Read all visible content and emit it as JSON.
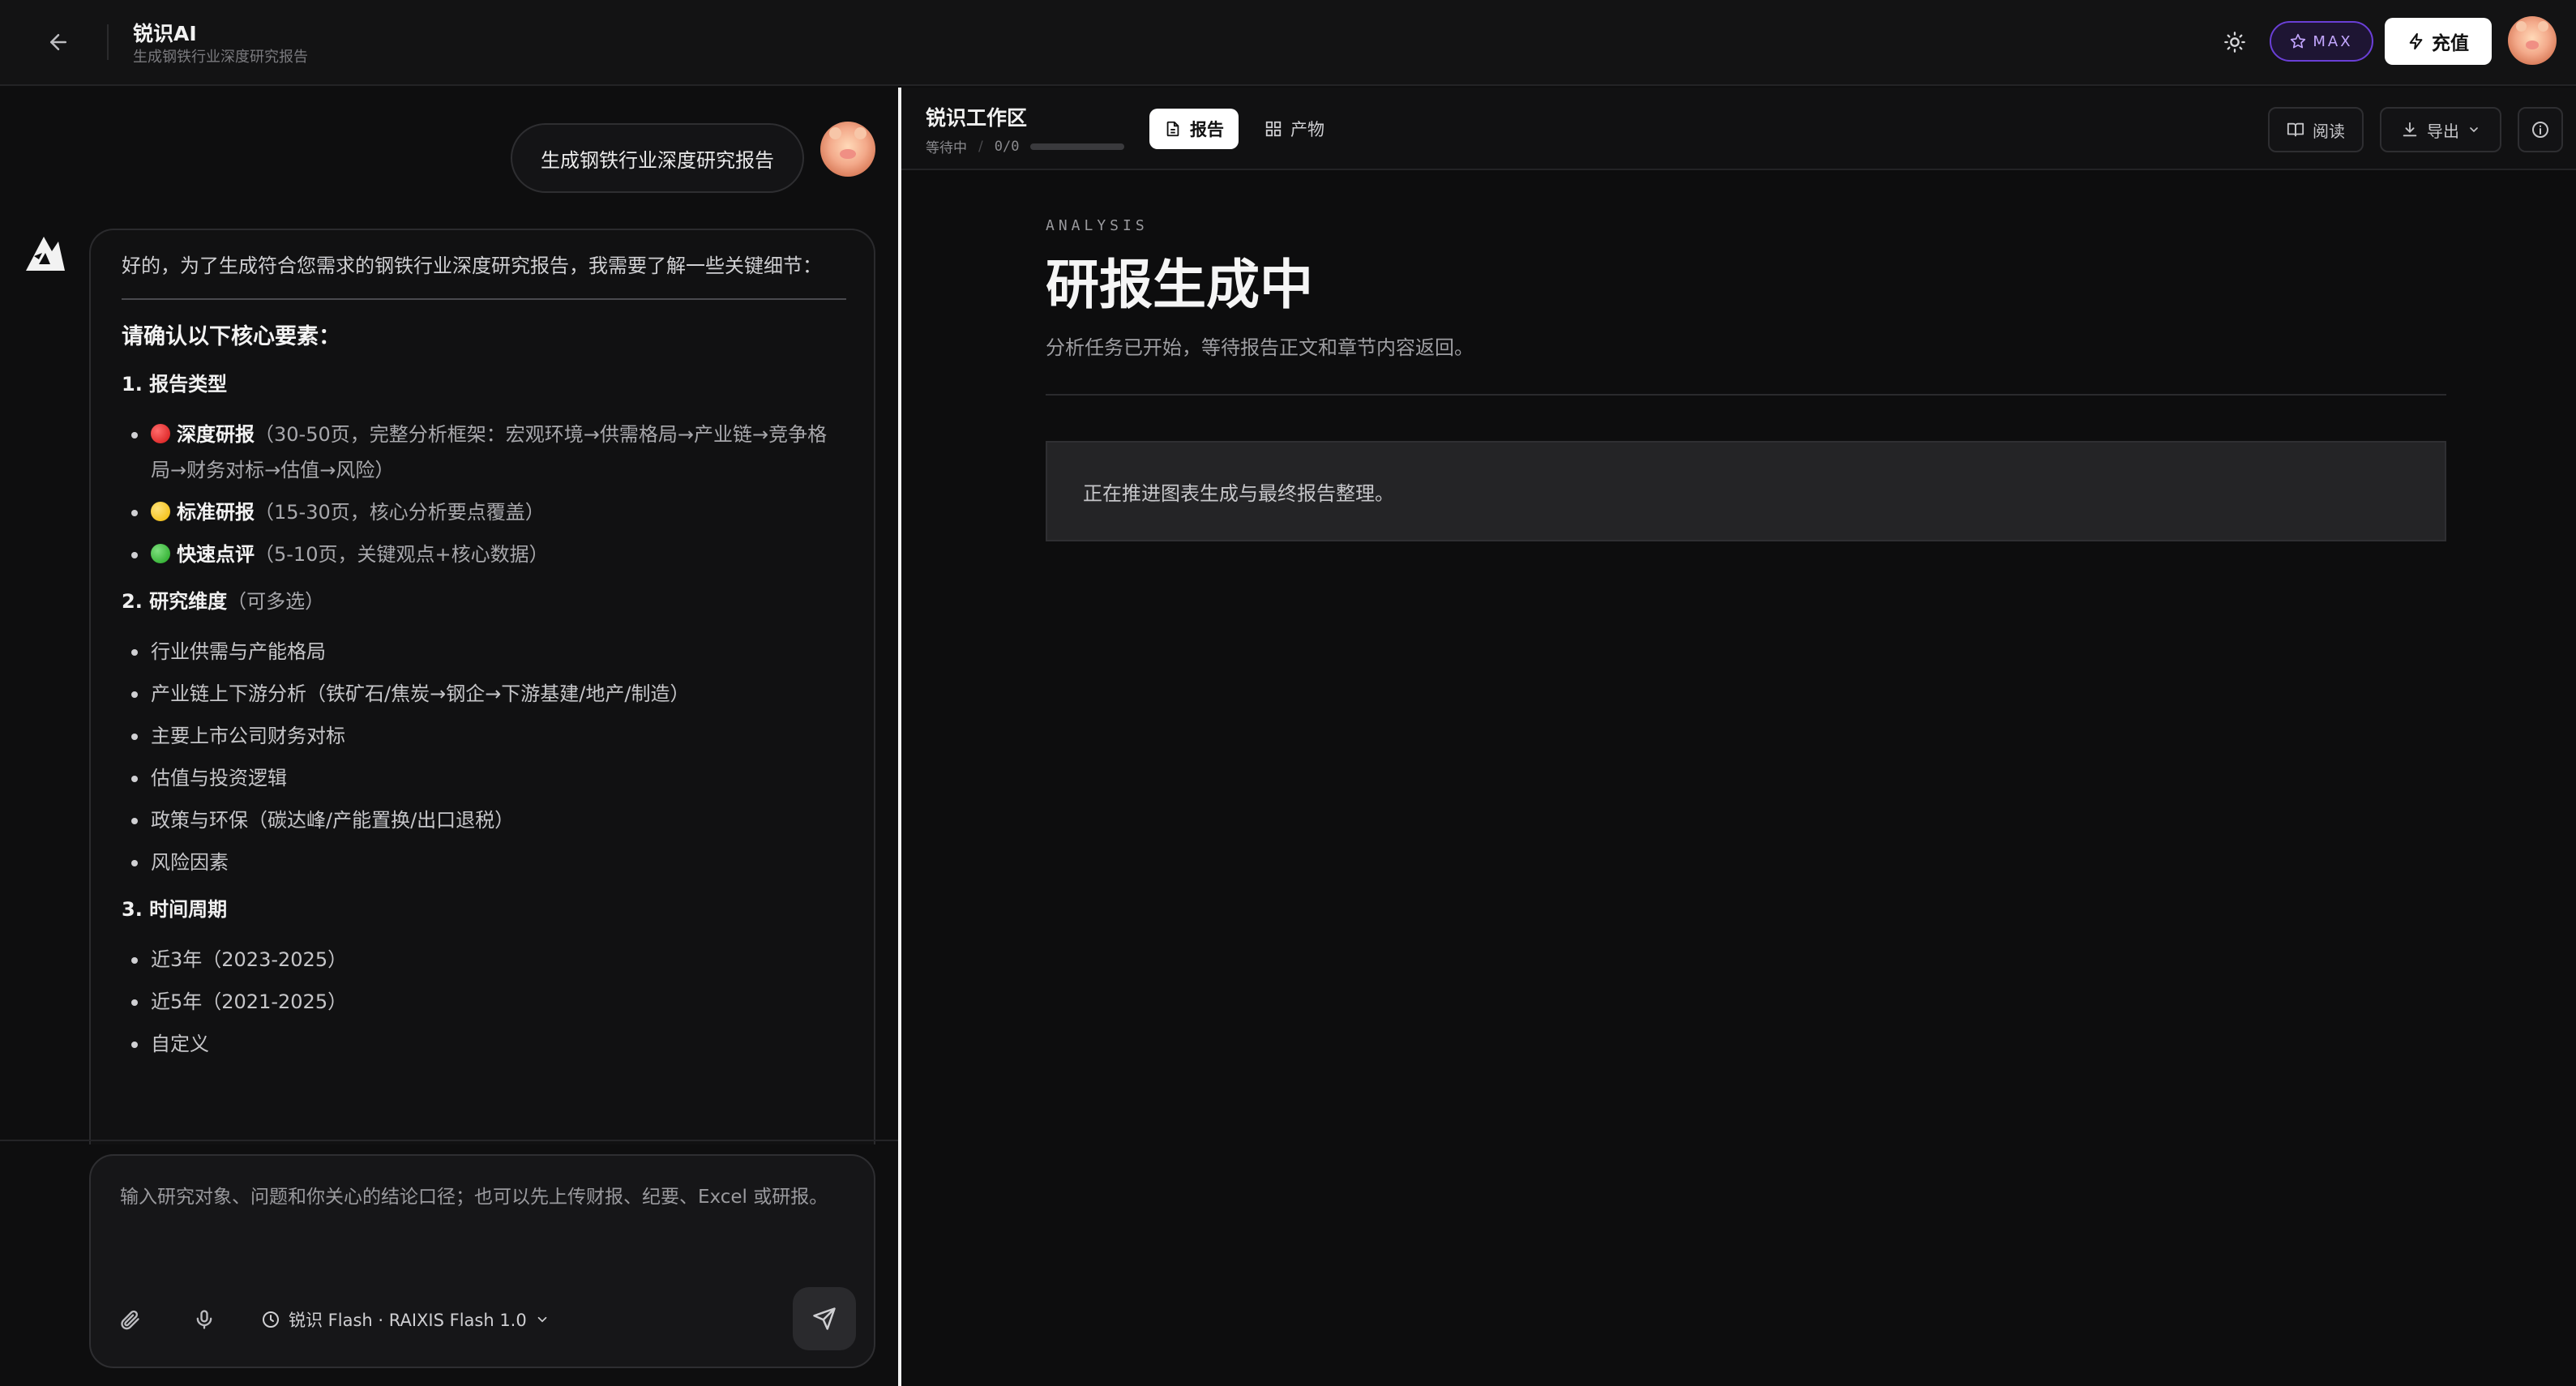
{
  "header": {
    "title": "锐识AI",
    "subtitle": "生成钢铁行业深度研究报告",
    "max_badge": "MAX",
    "recharge_label": "充值"
  },
  "chat": {
    "user_message": "生成钢铁行业深度研究报告",
    "bot": {
      "intro": "好的，为了生成符合您需求的钢铁行业深度研究报告，我需要了解一些关键细节：",
      "section_title": "请确认以下核心要素：",
      "q1_title": "1. 报告类型",
      "q1_items": [
        {
          "color": "red",
          "strong": "深度研报",
          "detail": "（30-50页，完整分析框架：宏观环境→供需格局→产业链→竞争格局→财务对标→估值→风险）"
        },
        {
          "color": "yellow",
          "strong": "标准研报",
          "detail": "（15-30页，核心分析要点覆盖）"
        },
        {
          "color": "green",
          "strong": "快速点评",
          "detail": "（5-10页，关键观点+核心数据）"
        }
      ],
      "q2_title": "2. 研究维度",
      "q2_note": "（可多选）",
      "q2_items": [
        "行业供需与产能格局",
        "产业链上下游分析（铁矿石/焦炭→钢企→下游基建/地产/制造）",
        "主要上市公司财务对标",
        "估值与投资逻辑",
        "政策与环保（碳达峰/产能置换/出口退税）",
        "风险因素"
      ],
      "q3_title": "3. 时间周期",
      "q3_items": [
        "近3年（2023-2025）",
        "近5年（2021-2025）",
        "自定义"
      ]
    },
    "composer": {
      "placeholder": "输入研究对象、问题和你关心的结论口径；也可以先上传财报、纪要、Excel 或研报。",
      "model_label": "锐识 Flash · RAIXIS Flash 1.0"
    }
  },
  "workspace": {
    "title": "锐识工作区",
    "status": "等待中",
    "progress_text": "0/0",
    "progress_fraction": 0,
    "tabs": {
      "report": "报告",
      "artifacts": "产物"
    },
    "read_label": "阅读",
    "export_label": "导出",
    "doc": {
      "eyebrow": "ANALYSIS",
      "title": "研报生成中",
      "subtitle": "分析任务已开始，等待报告正文和章节内容返回。",
      "notice": "正在推进图表生成与最终报告整理。"
    }
  },
  "icons": [
    "back-arrow-icon",
    "sun-icon",
    "star-icon",
    "bolt-icon",
    "logo-icon",
    "paperclip-icon",
    "mic-icon",
    "clock-icon",
    "chevron-down-icon",
    "send-icon",
    "document-icon",
    "grid-icon",
    "book-icon",
    "download-icon",
    "info-icon"
  ]
}
